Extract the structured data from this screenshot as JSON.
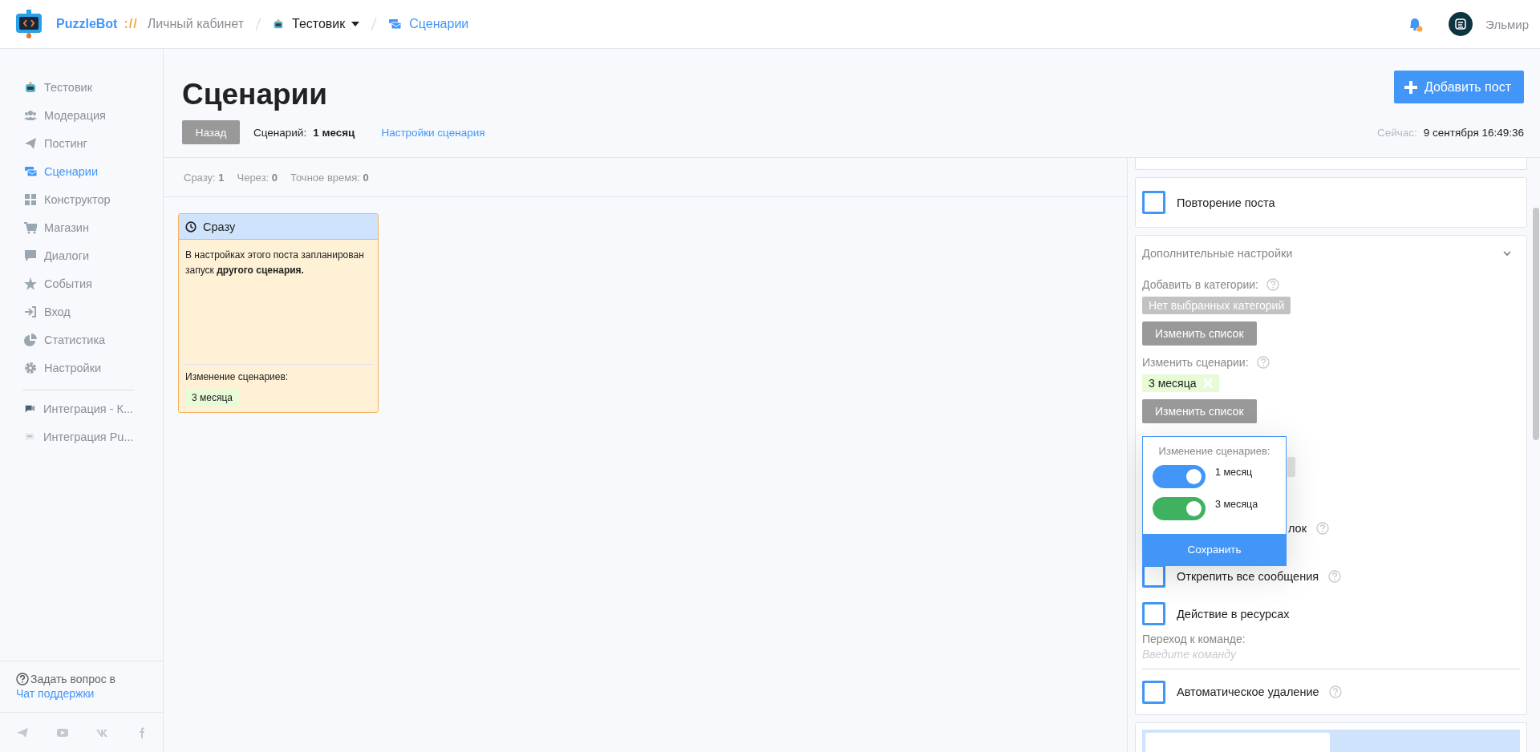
{
  "topbar": {
    "brand": "PuzzleBot",
    "brand_separator": "://",
    "breadcrumbs": [
      {
        "label": "Личный кабинет",
        "kind": "text"
      },
      {
        "label": "Тестовик",
        "kind": "dropdown"
      },
      {
        "label": "Сценарии",
        "kind": "link"
      }
    ],
    "notifications": {
      "unread": true
    },
    "user": {
      "name": "Эльмир"
    }
  },
  "sidebar": {
    "items": [
      {
        "label": "Тестовик",
        "selected": false
      },
      {
        "label": "Модерация",
        "selected": false
      },
      {
        "label": "Постинг",
        "selected": false
      },
      {
        "label": "Сценарии",
        "selected": true
      },
      {
        "label": "Конструктор",
        "selected": false
      },
      {
        "label": "Магазин",
        "selected": false
      },
      {
        "label": "Диалоги",
        "selected": false
      },
      {
        "label": "События",
        "selected": false
      },
      {
        "label": "Вход",
        "selected": false
      },
      {
        "label": "Статистика",
        "selected": false
      },
      {
        "label": "Настройки",
        "selected": false
      }
    ],
    "integrations": [
      {
        "label": "Интеграция - К..."
      },
      {
        "label": "Интеграция Pu..."
      }
    ],
    "help": {
      "text": "Задать вопрос в",
      "link": "Чат поддержки"
    }
  },
  "page": {
    "title": "Сценарии",
    "add_button": "Добавить пост",
    "back_button": "Назад",
    "scenario_label": "Сценарий:",
    "scenario_name": "1 месяц",
    "settings_link": "Настройки сценария",
    "now_label": "Сейчас:",
    "now_value": "9 сентября 16:49:36"
  },
  "stats": [
    {
      "label": "Сразу:",
      "value": "1"
    },
    {
      "label": "Через:",
      "value": "0"
    },
    {
      "label": "Точное время:",
      "value": "0"
    }
  ],
  "posts": [
    {
      "header": "Сразу",
      "body": "В настройках этого поста запланирован запуск **другого сценария.**",
      "footer_label": "Изменение сценариев:",
      "tags": [
        "3 месяца"
      ]
    }
  ],
  "panel": {
    "repeat": {
      "label": "Повторение поста",
      "checked": false
    },
    "advanced": {
      "title": "Дополнительные настройки",
      "expanded": true,
      "categories_label": "Добавить в категории:",
      "categories_empty": "Нет выбранных категорий",
      "categories_button": "Изменить список",
      "scenarios_label": "Изменить сценарии:",
      "scenario_tags": [
        {
          "label": "3 месяца"
        }
      ],
      "scenarios_button": "Изменить список",
      "covered_label": "лок",
      "options": [
        {
          "label": "Открепить все сообщения",
          "checked": false,
          "help": true
        },
        {
          "label": "Действие в ресурсах",
          "checked": false,
          "help": false
        }
      ],
      "command_label": "Переход к команде:",
      "command_placeholder": "Введите команду",
      "auto_delete": {
        "label": "Автоматическое удаление",
        "checked": false
      }
    }
  },
  "popup": {
    "title": "Изменение сценариев:",
    "toggles": [
      {
        "label": "1 месяц",
        "on": true,
        "color": "#4196f8"
      },
      {
        "label": "3 месяца",
        "on": true,
        "color": "#3fb260"
      }
    ],
    "save_button": "Сохранить"
  }
}
